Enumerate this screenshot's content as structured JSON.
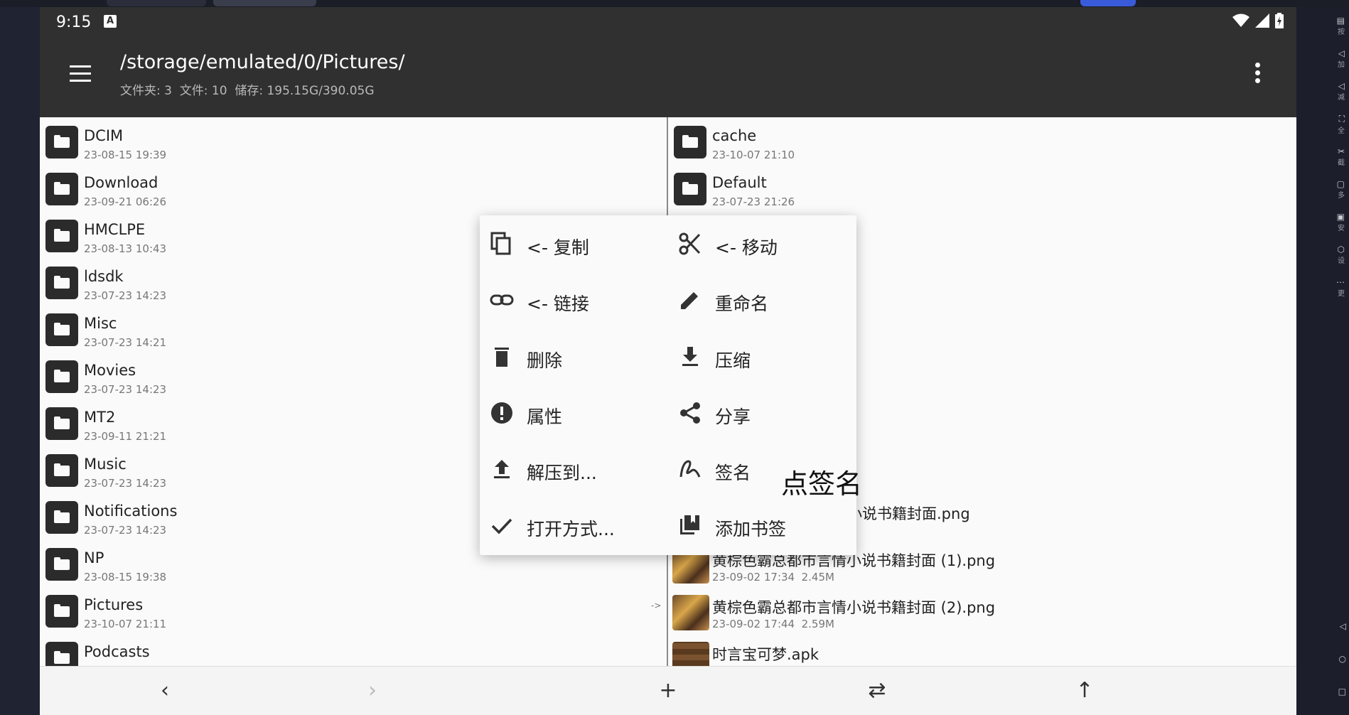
{
  "status_bar": {
    "time": "9:15",
    "a_icon": "A"
  },
  "app_bar": {
    "title": "/storage/emulated/0/Pictures/",
    "subtitle": "文件夹: 3  文件: 10  储存: 195.15G/390.05G"
  },
  "left_pane": {
    "items": [
      {
        "name": "DCIM",
        "meta": "23-08-15 19:39"
      },
      {
        "name": "Download",
        "meta": "23-09-21 06:26"
      },
      {
        "name": "HMCLPE",
        "meta": "23-08-13 10:43"
      },
      {
        "name": "ldsdk",
        "meta": "23-07-23 14:23"
      },
      {
        "name": "Misc",
        "meta": "23-07-23 14:21"
      },
      {
        "name": "Movies",
        "meta": "23-07-23 14:23"
      },
      {
        "name": "MT2",
        "meta": "23-09-11 21:21"
      },
      {
        "name": "Music",
        "meta": "23-07-23 14:23"
      },
      {
        "name": "Notifications",
        "meta": "23-07-23 14:23"
      },
      {
        "name": "NP",
        "meta": "23-08-15 19:38"
      },
      {
        "name": "Pictures",
        "meta": "23-10-07 21:11"
      },
      {
        "name": "Podcasts",
        "meta": ""
      }
    ],
    "current_marker": "->"
  },
  "right_pane": {
    "items": [
      {
        "name": "cache",
        "meta": "23-10-07 21:10"
      },
      {
        "name": "Default",
        "meta": "23-07-23 21:26"
      },
      {
        "name": "小说书籍封面.png",
        "meta": ""
      },
      {
        "name": "黄棕色霸总都市言情小说书籍封面 (1).png",
        "meta": "23-09-02 17:34  2.45M"
      },
      {
        "name": "黄棕色霸总都市言情小说书籍封面 (2).png",
        "meta": "23-09-02 17:44  2.59M"
      },
      {
        "name": "时言宝可梦.apk",
        "meta": ""
      }
    ]
  },
  "context_menu": {
    "items": [
      {
        "label": "<- 复制",
        "icon": "copy-icon"
      },
      {
        "label": "<- 移动",
        "icon": "cut-icon"
      },
      {
        "label": "<- 链接",
        "icon": "link-icon"
      },
      {
        "label": "重命名",
        "icon": "pencil-icon"
      },
      {
        "label": "删除",
        "icon": "trash-icon"
      },
      {
        "label": "压缩",
        "icon": "download-icon"
      },
      {
        "label": "属性",
        "icon": "info-icon"
      },
      {
        "label": "分享",
        "icon": "share-icon"
      },
      {
        "label": "解压到...",
        "icon": "upload-icon"
      },
      {
        "label": "签名",
        "icon": "signature-icon"
      },
      {
        "label": "打开方式...",
        "icon": "check-icon"
      },
      {
        "label": "添加书签",
        "icon": "bookmark-icon"
      }
    ]
  },
  "overlay_caption": "点签名",
  "bottom_bar": {
    "back": "‹",
    "forward": "›",
    "add": "+",
    "swap": "⇄",
    "up": "↑"
  },
  "host_toolbar": [
    "按",
    "加",
    "减",
    "全",
    "截",
    "多",
    "安",
    "设",
    "更"
  ],
  "colors": {
    "appbar": "#303030",
    "background": "#fafafa",
    "folder": "#2b2b2b"
  }
}
